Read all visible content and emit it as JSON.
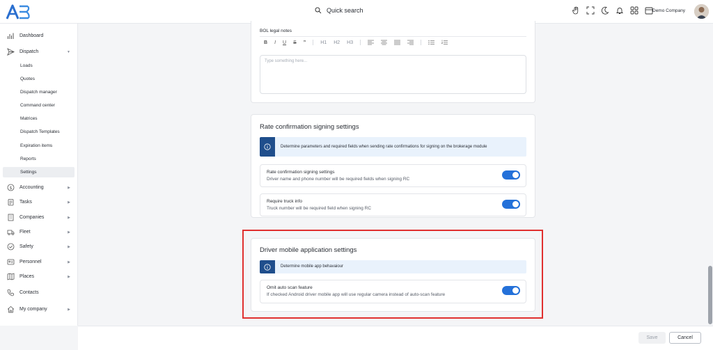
{
  "header": {
    "search_label": "Quick search",
    "company_name": "Demo Company",
    "icons": [
      "hand-icon",
      "fullscreen-icon",
      "moon-icon",
      "bell-icon",
      "apps-grid-icon",
      "calendar-icon"
    ]
  },
  "sidebar": {
    "dashboard": "Dashboard",
    "dispatch": "Dispatch",
    "dispatch_sub": [
      "Loads",
      "Quotes",
      "Dispatch manager",
      "Command center",
      "Matrices",
      "Dispatch Templates",
      "Expiration items",
      "Reports",
      "Settings"
    ],
    "active_sub": "Settings",
    "items": [
      "Accounting",
      "Tasks",
      "Companies",
      "Fleet",
      "Safety",
      "Personnel",
      "Places"
    ],
    "contacts": "Contacts",
    "my_company": "My company"
  },
  "bol": {
    "label": "BOL legal notes",
    "toolbar": [
      "B",
      "I",
      "U",
      "S",
      "”",
      "H1",
      "H2",
      "H3"
    ],
    "placeholder": "Type something here..."
  },
  "rate_confirmation": {
    "title": "Rate confirmation signing settings",
    "info": "Determine parameters and required fields when sending rate confirmations for signing on the brokerage module",
    "settings": [
      {
        "title": "Rate confirmation signing settings",
        "desc": "Driver name and phone number will be required fields when signing RC",
        "enabled": true
      },
      {
        "title": "Require truck info",
        "desc": "Truck number will be required field when signing RC",
        "enabled": true
      }
    ]
  },
  "driver_app": {
    "title": "Driver mobile application settings",
    "info": "Determine mobile app behavaiour",
    "settings": [
      {
        "title": "Omit auto scan feature",
        "desc": "If checked Android driver mobile app will use regular camera instead of auto-scan feature",
        "enabled": true
      }
    ]
  },
  "footer": {
    "save_label": "Save",
    "cancel_label": "Cancel"
  },
  "colors": {
    "accent": "#2471d9",
    "info_icon_bg": "#1f4e8c",
    "highlight": "#e0302f"
  }
}
